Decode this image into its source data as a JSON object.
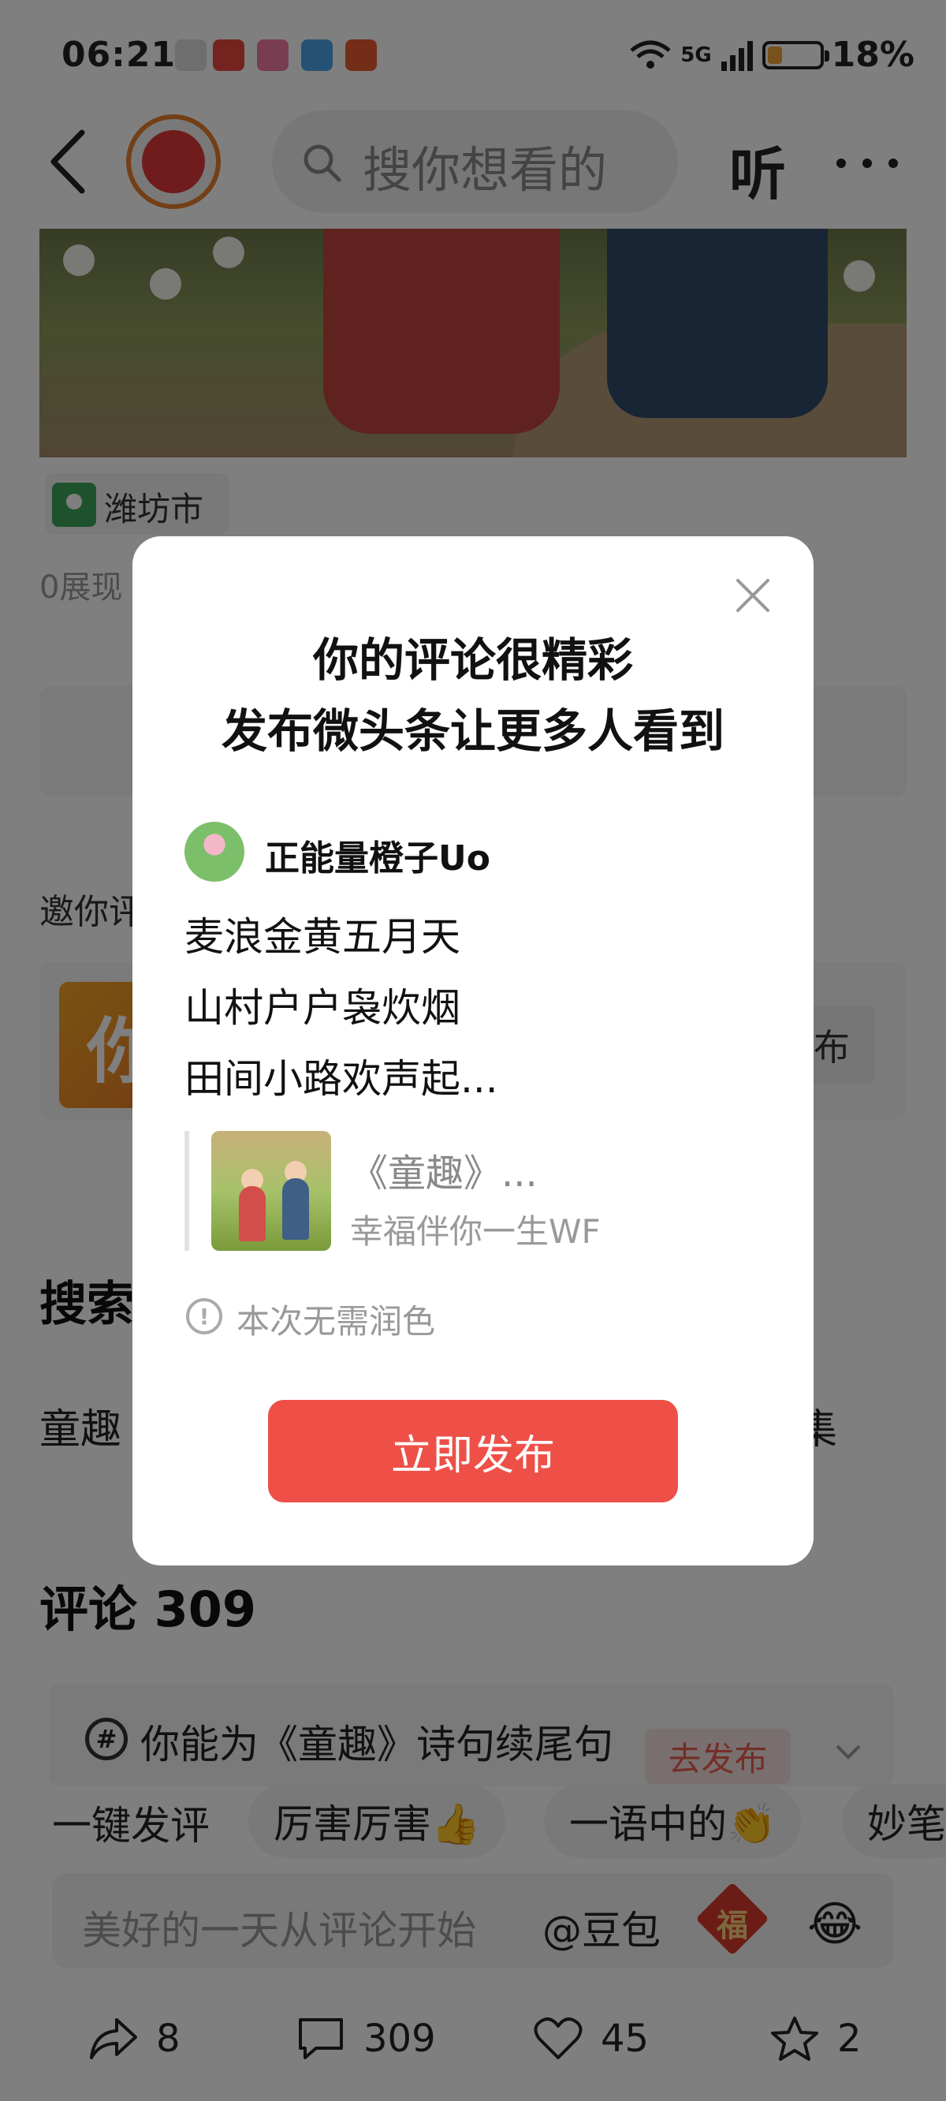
{
  "status_bar": {
    "time": "06:21",
    "network": "5G",
    "battery": "18%"
  },
  "header": {
    "search_placeholder": "搜你想看的",
    "listen_label": "听"
  },
  "post": {
    "location": "潍坊市",
    "views": "0展现"
  },
  "invite": {
    "label": "邀你评",
    "avatar_char": "你",
    "button": "布"
  },
  "search_section": {
    "title": "搜索",
    "left_item": "童趣",
    "right_item": "集"
  },
  "comments": {
    "title": "评论 309",
    "topic_text": "你能为《童趣》诗句续尾句",
    "topic_button": "去发布"
  },
  "quick_replies": [
    "一键发评",
    "厉害厉害👍",
    "一语中的👏",
    "妙笔"
  ],
  "comment_input": {
    "placeholder": "美好的一天从评论开始",
    "mention": "@豆包",
    "fu_char": "福",
    "emoji": "😂"
  },
  "actions": {
    "share": "8",
    "comment": "309",
    "like": "45",
    "favorite": "2"
  },
  "modal": {
    "title_line1": "你的评论很精彩",
    "title_line2": "发布微头条让更多人看到",
    "user_name": "正能量橙子Uo",
    "lines": [
      "麦浪金黄五月天",
      "山村户户袅炊烟",
      "田间小路欢声起..."
    ],
    "quote_title": "《童趣》...",
    "quote_author": "幸福伴你一生WF",
    "info": "本次无需润色",
    "publish_button": "立即发布"
  },
  "colors": {
    "accent": "#ee5047",
    "overlay": "rgba(0,0,0,0.5)"
  }
}
